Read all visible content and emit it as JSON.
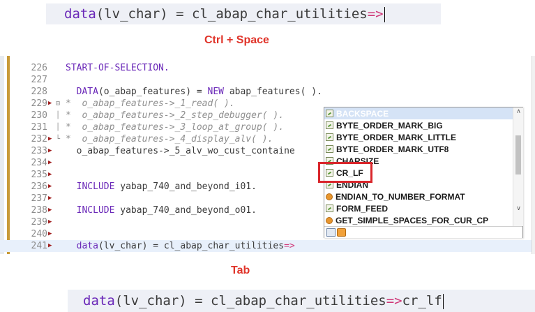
{
  "top_snippet": {
    "code_keyword": "data",
    "code_rest": "(lv_char) = cl_abap_char_utilities",
    "code_arrow": "=>"
  },
  "caption_ctrl_space": "Ctrl + Space",
  "editor": {
    "lines": [
      {
        "num": "226",
        "marker": "",
        "fold": "",
        "parts": [
          {
            "t": "START-OF-SELECTION.",
            "c": "kwd"
          }
        ]
      },
      {
        "num": "227",
        "marker": "",
        "fold": "",
        "parts": []
      },
      {
        "num": "228",
        "marker": "",
        "fold": "",
        "parts": [
          {
            "t": "  DATA",
            "c": "kwd"
          },
          {
            "t": "(o_abap_features) = ",
            "c": "str"
          },
          {
            "t": "NEW",
            "c": "kwd"
          },
          {
            "t": " abap_features( ).",
            "c": "str"
          }
        ]
      },
      {
        "num": "229",
        "marker": "▶",
        "fold": "⊟",
        "parts": [
          {
            "t": "*  o_abap_features->_1_read( ).",
            "c": "cmt"
          }
        ]
      },
      {
        "num": "230",
        "marker": "",
        "fold": "│",
        "parts": [
          {
            "t": "*  o_abap_features->_2_step_debugger( ).",
            "c": "cmt"
          }
        ]
      },
      {
        "num": "231",
        "marker": "",
        "fold": "│",
        "parts": [
          {
            "t": "*  o_abap_features->_3_loop_at_group( ).",
            "c": "cmt"
          }
        ]
      },
      {
        "num": "232",
        "marker": "▶",
        "fold": "└",
        "parts": [
          {
            "t": "*  o_abap_features->_4_display_alv( ).",
            "c": "cmt"
          }
        ]
      },
      {
        "num": "233",
        "marker": "▶",
        "fold": "",
        "parts": [
          {
            "t": "  o_abap_features->_5_alv_wo_cust_containe",
            "c": "str"
          }
        ]
      },
      {
        "num": "234",
        "marker": "▶",
        "fold": "",
        "parts": []
      },
      {
        "num": "235",
        "marker": "▶",
        "fold": "",
        "parts": []
      },
      {
        "num": "236",
        "marker": "▶",
        "fold": "",
        "parts": [
          {
            "t": "  INCLUDE",
            "c": "kwd"
          },
          {
            "t": " yabap_740_and_beyond_i01.",
            "c": "str"
          }
        ]
      },
      {
        "num": "237",
        "marker": "▶",
        "fold": "",
        "parts": []
      },
      {
        "num": "238",
        "marker": "▶",
        "fold": "",
        "parts": [
          {
            "t": "  INCLUDE",
            "c": "kwd"
          },
          {
            "t": " yabap_740_and_beyond_o01.",
            "c": "str"
          }
        ]
      },
      {
        "num": "239",
        "marker": "▶",
        "fold": "",
        "parts": []
      },
      {
        "num": "240",
        "marker": "▶",
        "fold": "",
        "parts": []
      },
      {
        "num": "241",
        "marker": "▶",
        "fold": "",
        "current": true,
        "parts": [
          {
            "t": "  data",
            "c": "kwd"
          },
          {
            "t": "(lv_char) = cl_abap_char_utilities",
            "c": "str"
          },
          {
            "t": "=>",
            "c": "mag"
          }
        ]
      }
    ]
  },
  "autocomplete": {
    "items": [
      {
        "label": "BACKSPACE",
        "icon": "attribute-icon",
        "selected": true
      },
      {
        "label": "BYTE_ORDER_MARK_BIG",
        "icon": "attribute-icon"
      },
      {
        "label": "BYTE_ORDER_MARK_LITTLE",
        "icon": "attribute-icon"
      },
      {
        "label": "BYTE_ORDER_MARK_UTF8",
        "icon": "attribute-icon"
      },
      {
        "label": "CHARSIZE",
        "icon": "attribute-icon"
      },
      {
        "label": "CR_LF",
        "icon": "attribute-icon",
        "highlighted": true
      },
      {
        "label": "ENDIAN",
        "icon": "attribute-icon"
      },
      {
        "label": "ENDIAN_TO_NUMBER_FORMAT",
        "icon": "method-icon"
      },
      {
        "label": "FORM_FEED",
        "icon": "attribute-icon"
      },
      {
        "label": "GET_SIMPLE_SPACES_FOR_CUR_CP",
        "icon": "method-icon"
      }
    ],
    "scroll_up": "∧",
    "scroll_down": "∨"
  },
  "caption_tab": "Tab",
  "bottom_snippet": {
    "code_keyword": "data",
    "code_rest": "(lv_char) = cl_abap_char_utilities",
    "code_arrow": "=>",
    "code_completion": "cr_lf"
  },
  "colors": {
    "keyword": "#6a28b8",
    "arrow": "#d03878",
    "caption": "#e0342a",
    "highlight_box": "#d9262b"
  }
}
